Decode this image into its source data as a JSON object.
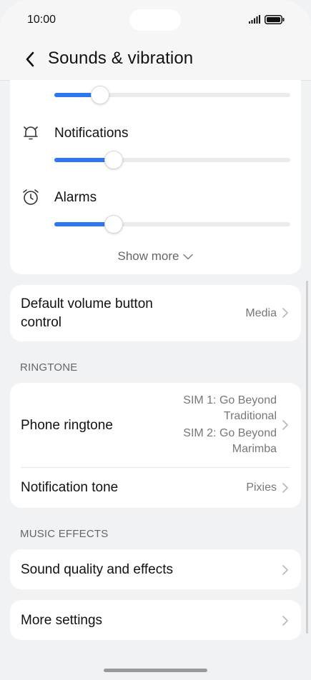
{
  "status_bar": {
    "time": "10:00"
  },
  "header": {
    "title": "Sounds & vibration"
  },
  "volume": {
    "sliders": [
      {
        "id": "media",
        "label": "",
        "level": 0.19
      },
      {
        "id": "notifications",
        "label": "Notifications",
        "level": 0.25
      },
      {
        "id": "alarms",
        "label": "Alarms",
        "level": 0.25
      }
    ],
    "show_more": "Show more"
  },
  "default_volume": {
    "label_line1": "Default volume button",
    "label_line2": "control",
    "value": "Media"
  },
  "ringtone": {
    "section_title": "RINGTONE",
    "phone_ringtone": {
      "label": "Phone ringtone",
      "value_lines": [
        "SIM 1: Go Beyond",
        "Traditional",
        "SIM 2: Go Beyond",
        "Marimba"
      ]
    },
    "notification_tone": {
      "label": "Notification tone",
      "value": "Pixies"
    }
  },
  "music_effects": {
    "section_title": "MUSIC EFFECTS",
    "sound_quality": {
      "label": "Sound quality and effects"
    }
  },
  "more_settings": {
    "label": "More settings"
  },
  "colors": {
    "accent": "#2f77f0",
    "background": "#f1f2f4",
    "card": "#ffffff"
  }
}
